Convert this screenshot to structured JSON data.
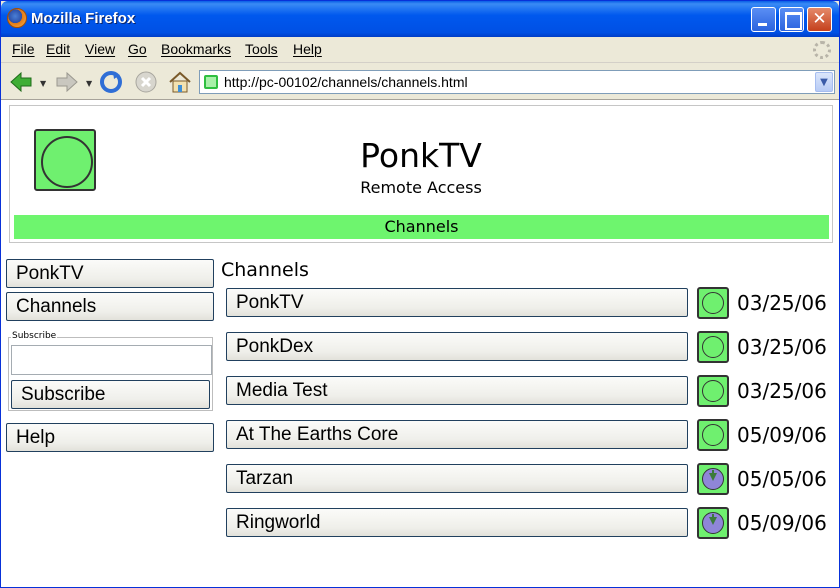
{
  "window": {
    "title": "Mozilla Firefox",
    "close_glyph": "✕"
  },
  "menu": [
    "File",
    "Edit",
    "View",
    "Go",
    "Bookmarks",
    "Tools",
    "Help"
  ],
  "navigation": {
    "url": "http://pc-00102/channels/channels.html",
    "icons": [
      "back-icon",
      "forward-icon",
      "reload-icon",
      "stop-icon",
      "home-icon"
    ]
  },
  "header": {
    "title": "PonkTV",
    "subtitle": "Remote Access",
    "section": "Channels",
    "accent_color": "#6ef56e"
  },
  "sidebar": {
    "items": [
      "PonkTV",
      "Channels"
    ],
    "subscribe_legend": "Subscribe",
    "subscribe_input_value": "",
    "subscribe_button": "Subscribe",
    "help": "Help"
  },
  "channels": {
    "heading": "Channels",
    "rows": [
      {
        "name": "PonkTV",
        "status": "subscribed",
        "date": "03/25/06"
      },
      {
        "name": "PonkDex",
        "status": "subscribed",
        "date": "03/25/06"
      },
      {
        "name": "Media Test",
        "status": "subscribed",
        "date": "03/25/06"
      },
      {
        "name": "At The Earths Core",
        "status": "subscribed",
        "date": "05/09/06"
      },
      {
        "name": "Tarzan",
        "status": "download",
        "date": "05/05/06"
      },
      {
        "name": "Ringworld",
        "status": "download",
        "date": "05/09/06"
      }
    ]
  }
}
